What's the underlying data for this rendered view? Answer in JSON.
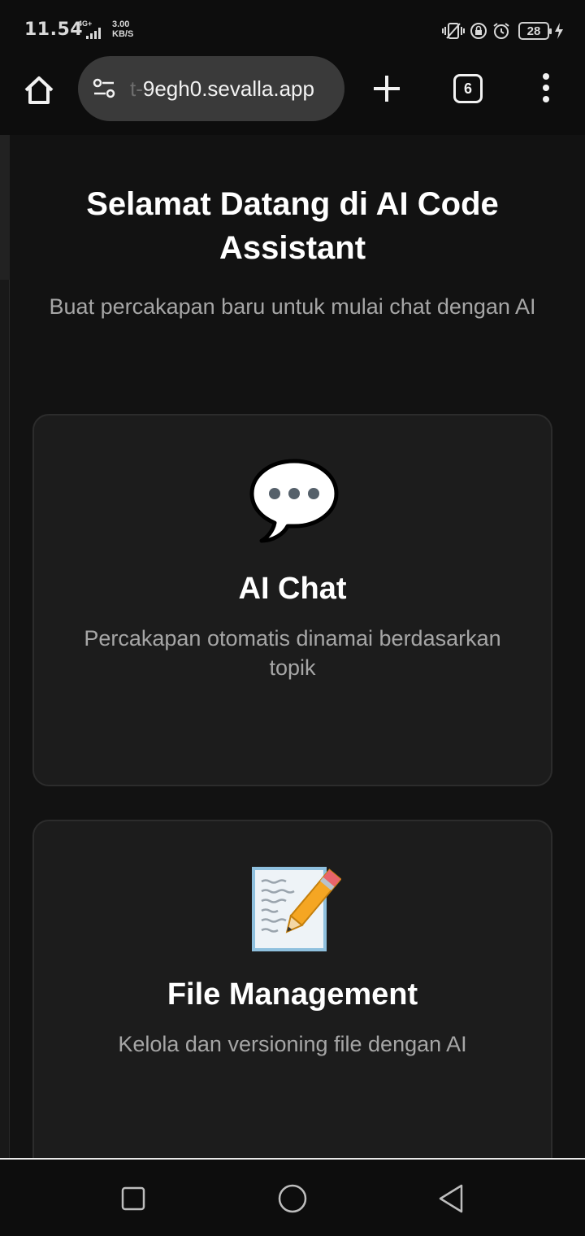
{
  "status_bar": {
    "time": "11.54",
    "network_type": "4G+",
    "speed_value": "3.00",
    "speed_unit": "KB/S",
    "battery": "28",
    "icons": [
      "vibrate-icon",
      "lock-rotation-icon",
      "alarm-icon",
      "battery-icon",
      "charging-icon"
    ]
  },
  "browser": {
    "url_fade": "t-",
    "url": "9egh0.sevalla.app",
    "tab_count": "6",
    "icons": [
      "home-icon",
      "site-settings-icon",
      "plus-icon",
      "tabs-icon",
      "more-vert-icon"
    ]
  },
  "page": {
    "title": "Selamat Datang di AI Code Assistant",
    "subtitle": "Buat percakapan baru untuk mulai chat dengan AI",
    "cards": [
      {
        "icon": "speech-bubble-icon",
        "title": "AI Chat",
        "description": "Percakapan otomatis dinamai berdasarkan topik"
      },
      {
        "icon": "memo-pencil-icon",
        "title": "File Management",
        "description": "Kelola dan versioning file dengan AI"
      }
    ]
  },
  "nav_bar": {
    "icons": [
      "recents-icon",
      "home-circle-icon",
      "back-icon"
    ]
  },
  "colors": {
    "background": "#121212",
    "card_background": "#1c1c1c",
    "card_border": "#2c2c2c",
    "title_text": "#ffffff",
    "muted_text": "#a6a6a6",
    "url_pill": "#3a3a3a"
  }
}
